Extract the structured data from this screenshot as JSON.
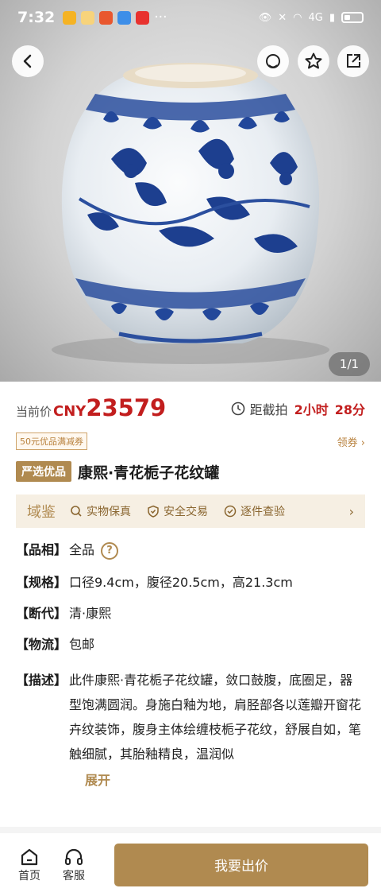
{
  "status_bar": {
    "time": "7:32",
    "more": "···",
    "network": "4G"
  },
  "header": {
    "page_indicator": "1/1"
  },
  "price": {
    "label": "当前价",
    "currency": "CNY",
    "value": "23579",
    "countdown_label": "距截拍",
    "countdown_hours": "2小时",
    "countdown_minutes": "28分"
  },
  "coupon": {
    "label": "50元优品满减券",
    "link": "领券 ›"
  },
  "product": {
    "badge": "严选优品",
    "title": "康熙·青花栀子花纹罐"
  },
  "assurance": {
    "brand": "域鉴",
    "items": [
      "实物保真",
      "安全交易",
      "逐件查验"
    ],
    "arrow": "›"
  },
  "specs": {
    "condition": {
      "key": "【品相】",
      "value": "全品"
    },
    "size": {
      "key": "【规格】",
      "value": "口径9.4cm，腹径20.5cm，高21.3cm"
    },
    "period": {
      "key": "【断代】",
      "value": "清·康熙"
    },
    "shipping": {
      "key": "【物流】",
      "value": "包邮"
    },
    "description": {
      "key": "【描述】",
      "value": "此件康熙·青花栀子花纹罐，敛口鼓腹，底圈足，器型饱满圆润。身施白釉为地，肩胫部各以莲瓣开窗花卉纹装饰，腹身主体绘缠枝栀子花纹，舒展自如，笔触细腻，其胎釉精良，温润似",
      "expand": "展开"
    }
  },
  "bottom_bar": {
    "home": "首页",
    "service": "客服",
    "bid": "我要出价"
  },
  "colors": {
    "accent": "#b08a50",
    "price": "#c21e1e",
    "blue": "#1f3f8f"
  }
}
